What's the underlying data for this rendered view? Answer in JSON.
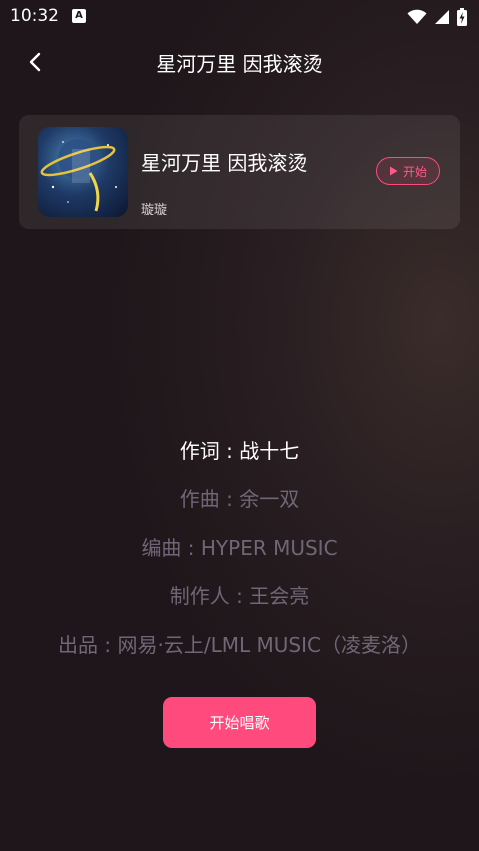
{
  "status_bar": {
    "time": "10:32",
    "badge": "A",
    "icons": [
      "wifi-icon",
      "signal-icon",
      "battery-charging-icon"
    ]
  },
  "nav": {
    "title": "星河万里 因我滚烫",
    "back_icon": "chevron-left-icon"
  },
  "song_card": {
    "title": "星河万里 因我滚烫",
    "singer": "璇璇",
    "start_label": "开始",
    "accent_color": "#ff4a7d"
  },
  "credits": [
    "作词 : 战十七",
    "作曲 : 余一双",
    "编曲 : HYPER MUSIC",
    "制作人 : 王会亮",
    "出品 : 网易·云上/LML MUSIC（凌麦洛）"
  ],
  "primary_button": {
    "label": "开始唱歌",
    "color": "#ff4a7d"
  }
}
